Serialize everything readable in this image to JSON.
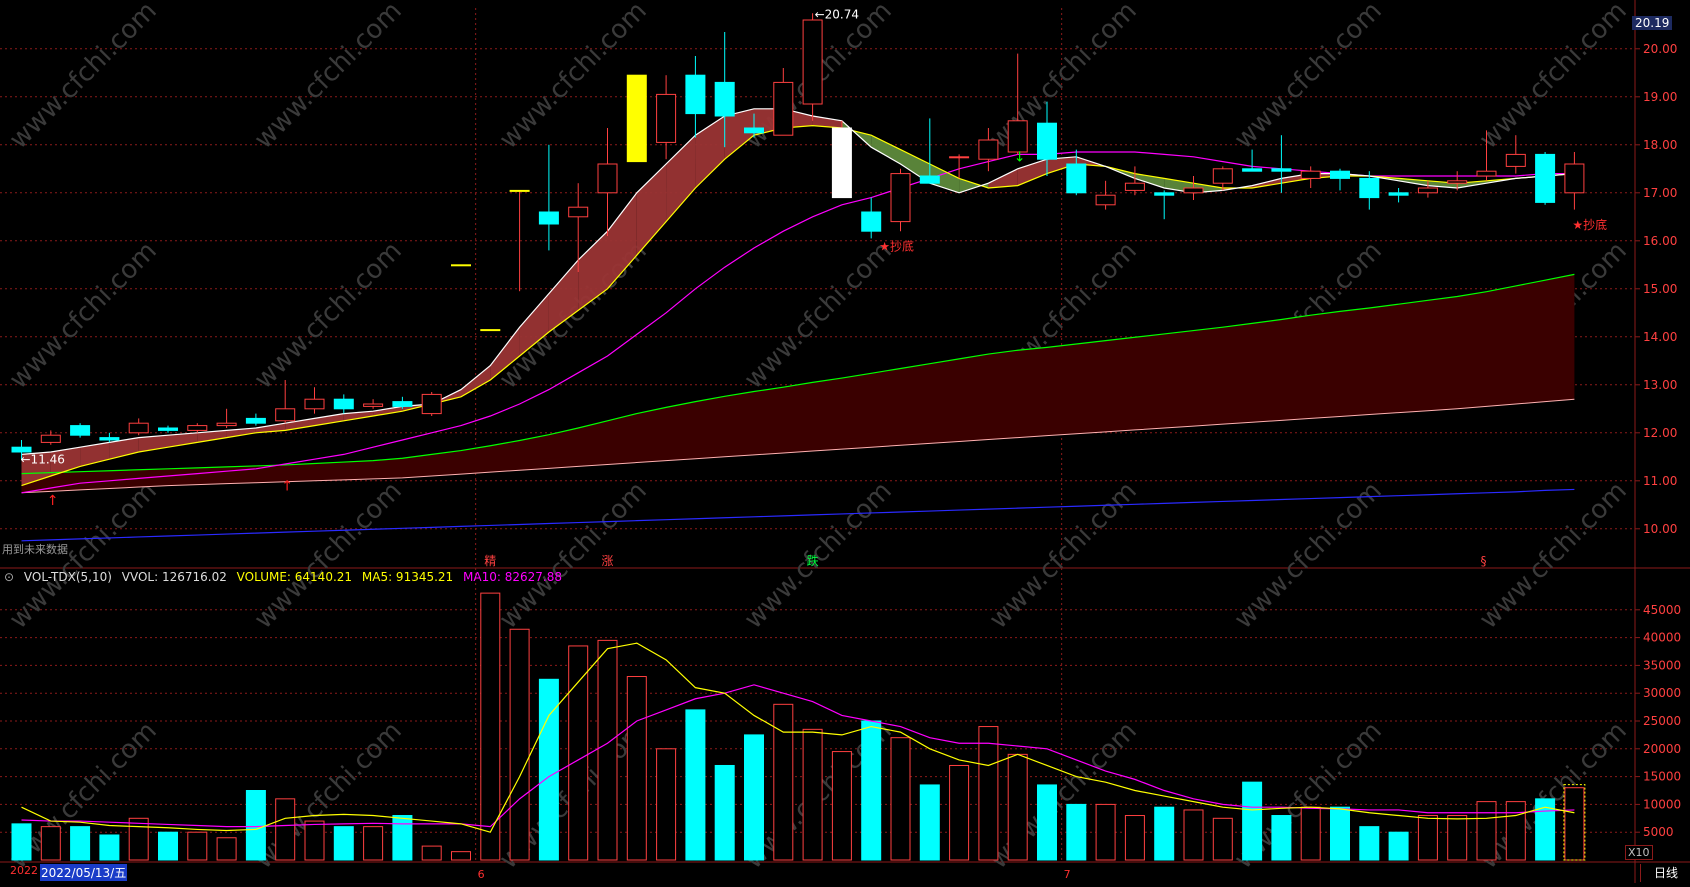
{
  "price_axis": {
    "labels": [
      "20.00",
      "19.00",
      "18.00",
      "17.00",
      "16.00",
      "15.00",
      "14.00",
      "13.00",
      "12.00",
      "11.00",
      "10.00"
    ],
    "current_tag": "20.19"
  },
  "volume_axis": {
    "labels": [
      "45000",
      "40000",
      "35000",
      "30000",
      "25000",
      "20000",
      "15000",
      "10000",
      "5000"
    ]
  },
  "price_annotations": {
    "high_label": "20.74",
    "low_label": "11.46",
    "signal_1": "★抄底",
    "signal_2": "★抄底"
  },
  "event_tags": [
    "精",
    "涨",
    "跌",
    "§"
  ],
  "hint_text": "用到未来数据",
  "indicator": {
    "name": "VOL-TDX(5,10)",
    "vvol": "VVOL: 126716.02",
    "volume": "VOLUME: 64140.21",
    "ma5": "MA5: 91345.21",
    "ma10": "MA10: 82627.88"
  },
  "x_axis": {
    "year_label": "2022",
    "selected_date": "2022/05/13/五",
    "month_6": "6",
    "month_7": "7",
    "scale_btn": "X10",
    "period_btn": "日线"
  },
  "watermark": "www.cfchi.com",
  "colors": {
    "bull": "#ff4040",
    "bear": "#00ffff",
    "ma5": "#ffffff",
    "ma10": "#ffff00",
    "ma20": "#ff00ff",
    "ma60": "#00ff00",
    "ma120": "#ffb0b0",
    "ma250": "#2a2aff",
    "grid": "#8b1a1a"
  },
  "chart_data": {
    "type": "candlestick",
    "candles": [
      [
        11.7,
        11.6,
        11.85,
        11.45
      ],
      [
        11.8,
        11.95,
        12.05,
        11.75
      ],
      [
        12.15,
        11.95,
        12.2,
        11.9
      ],
      [
        11.9,
        11.85,
        12.0,
        11.8
      ],
      [
        12.0,
        12.2,
        12.3,
        11.95
      ],
      [
        12.1,
        12.05,
        12.15,
        12.0
      ],
      [
        12.05,
        12.15,
        12.2,
        12.0
      ],
      [
        12.15,
        12.2,
        12.5,
        12.1
      ],
      [
        12.3,
        12.2,
        12.4,
        12.15
      ],
      [
        12.25,
        12.5,
        13.1,
        12.2
      ],
      [
        12.5,
        12.7,
        12.95,
        12.4
      ],
      [
        12.7,
        12.5,
        12.8,
        12.4
      ],
      [
        12.55,
        12.6,
        12.7,
        12.5
      ],
      [
        12.65,
        12.55,
        12.75,
        12.5
      ],
      [
        12.4,
        12.8,
        12.85,
        12.35
      ],
      [
        15.5,
        15.5,
        15.5,
        15.5
      ],
      [
        14.15,
        14.15,
        14.15,
        14.15
      ],
      [
        17.05,
        17.05,
        17.05,
        14.95
      ],
      [
        16.6,
        16.35,
        18.0,
        15.8
      ],
      [
        16.5,
        16.7,
        17.2,
        15.35
      ],
      [
        17.0,
        17.6,
        18.35,
        16.1
      ],
      [
        17.65,
        19.45,
        19.45,
        17.65
      ],
      [
        18.05,
        19.05,
        19.45,
        17.7
      ],
      [
        19.45,
        18.65,
        19.85,
        18.15
      ],
      [
        19.3,
        18.6,
        20.35,
        17.95
      ],
      [
        18.35,
        18.25,
        18.65,
        18.15
      ],
      [
        18.2,
        19.3,
        19.6,
        18.2
      ],
      [
        18.85,
        20.6,
        20.74,
        18.5
      ],
      [
        16.9,
        18.35,
        18.5,
        16.9
      ],
      [
        16.6,
        16.2,
        16.9,
        16.05
      ],
      [
        16.4,
        17.4,
        17.5,
        16.2
      ],
      [
        17.35,
        17.2,
        18.55,
        17.2
      ],
      [
        17.75,
        17.75,
        17.8,
        17.3
      ],
      [
        17.7,
        18.1,
        18.35,
        17.45
      ],
      [
        17.85,
        18.5,
        19.9,
        17.8
      ],
      [
        18.45,
        17.7,
        18.9,
        17.35
      ],
      [
        17.6,
        17.0,
        17.9,
        16.95
      ],
      [
        16.75,
        16.95,
        17.25,
        16.65
      ],
      [
        17.05,
        17.2,
        17.55,
        16.95
      ],
      [
        17.0,
        16.95,
        17.05,
        16.45
      ],
      [
        17.0,
        17.1,
        17.35,
        16.85
      ],
      [
        17.2,
        17.5,
        17.55,
        17.05
      ],
      [
        17.5,
        17.45,
        17.9,
        17.45
      ],
      [
        17.5,
        17.45,
        18.2,
        17.0
      ],
      [
        17.3,
        17.45,
        17.55,
        17.1
      ],
      [
        17.45,
        17.3,
        17.5,
        17.05
      ],
      [
        17.3,
        16.9,
        17.45,
        16.65
      ],
      [
        17.0,
        16.95,
        17.1,
        16.8
      ],
      [
        17.0,
        17.1,
        17.25,
        16.9
      ],
      [
        17.2,
        17.25,
        17.45,
        17.05
      ],
      [
        17.35,
        17.45,
        18.3,
        17.25
      ],
      [
        17.55,
        17.8,
        18.2,
        17.4
      ],
      [
        17.8,
        16.8,
        17.85,
        16.75
      ],
      [
        17.0,
        17.6,
        17.85,
        16.65
      ]
    ],
    "volume": [
      6.5,
      6.0,
      6.0,
      4.5,
      7.5,
      5.0,
      5.0,
      4.0,
      12.5,
      11.0,
      7.0,
      6.0,
      6.0,
      8.0,
      2.5,
      1.5,
      48.0,
      41.5,
      32.5,
      38.5,
      39.5,
      33.0,
      20.0,
      27.0,
      17.0,
      22.5,
      28.0,
      23.5,
      19.5,
      25.0,
      22.0,
      13.5,
      17.0,
      24.0,
      19.0,
      13.5,
      10.0,
      10.0,
      8.0,
      9.5,
      9.0,
      7.5,
      14.0,
      8.0,
      9.5,
      9.5,
      6.0,
      5.0,
      8.0,
      8.0,
      10.5,
      10.5,
      11.0,
      13.0
    ],
    "vol_ma5": [
      9.5,
      7.0,
      6.8,
      6.2,
      6.0,
      5.8,
      5.5,
      5.3,
      5.5,
      7.5,
      8.0,
      8.2,
      8.0,
      7.5,
      7.0,
      6.5,
      5.0,
      15.0,
      26.0,
      32.0,
      38.0,
      39.0,
      36.0,
      31.0,
      30.0,
      26.0,
      23.0,
      23.0,
      22.5,
      24.0,
      23.0,
      20.0,
      18.0,
      17.0,
      19.0,
      17.0,
      15.0,
      14.0,
      12.5,
      11.5,
      10.5,
      9.5,
      9.0,
      9.3,
      9.5,
      9.2,
      8.5,
      8.0,
      7.5,
      7.4,
      7.5,
      8.0,
      9.5,
      8.5
    ],
    "vol_ma10": [
      7.2,
      7.0,
      7.0,
      6.8,
      6.6,
      6.4,
      6.2,
      6.0,
      6.0,
      6.2,
      6.4,
      6.5,
      6.6,
      6.5,
      6.5,
      6.5,
      6.0,
      11.0,
      15.0,
      18.0,
      21.0,
      25.0,
      27.0,
      29.0,
      30.0,
      31.5,
      30.0,
      28.5,
      26.0,
      25.0,
      24.0,
      22.0,
      21.0,
      21.0,
      20.5,
      20.0,
      18.0,
      16.0,
      14.5,
      12.5,
      11.0,
      10.0,
      9.5,
      9.5,
      9.3,
      9.2,
      9.0,
      9.0,
      8.5,
      8.5,
      8.5,
      8.5,
      8.8,
      9.0
    ],
    "ma5": [
      11.55,
      11.6,
      11.7,
      11.8,
      11.9,
      11.95,
      12.0,
      12.05,
      12.1,
      12.2,
      12.3,
      12.4,
      12.45,
      12.55,
      12.6,
      12.9,
      13.4,
      14.2,
      14.9,
      15.6,
      16.2,
      17.0,
      17.6,
      18.2,
      18.6,
      18.75,
      18.75,
      18.6,
      18.5,
      17.95,
      17.6,
      17.2,
      17.0,
      17.2,
      17.5,
      17.7,
      17.75,
      17.55,
      17.3,
      17.1,
      17.0,
      17.05,
      17.15,
      17.3,
      17.4,
      17.4,
      17.35,
      17.25,
      17.15,
      17.1,
      17.2,
      17.3,
      17.35,
      17.4
    ],
    "ma10": [
      10.9,
      11.1,
      11.3,
      11.45,
      11.6,
      11.7,
      11.8,
      11.9,
      12.0,
      12.05,
      12.15,
      12.25,
      12.35,
      12.45,
      12.6,
      12.75,
      13.1,
      13.6,
      14.1,
      14.55,
      15.0,
      15.7,
      16.4,
      17.1,
      17.7,
      18.2,
      18.35,
      18.4,
      18.35,
      18.2,
      17.9,
      17.6,
      17.3,
      17.1,
      17.15,
      17.4,
      17.6,
      17.55,
      17.4,
      17.3,
      17.2,
      17.1,
      17.1,
      17.2,
      17.3,
      17.35,
      17.35,
      17.3,
      17.25,
      17.2,
      17.25,
      17.3,
      17.35,
      17.4
    ],
    "ma20": [
      10.75,
      10.85,
      10.95,
      11.0,
      11.05,
      11.1,
      11.15,
      11.2,
      11.25,
      11.35,
      11.45,
      11.55,
      11.7,
      11.85,
      12.0,
      12.15,
      12.35,
      12.6,
      12.9,
      13.25,
      13.6,
      14.05,
      14.5,
      15.0,
      15.45,
      15.85,
      16.2,
      16.5,
      16.75,
      16.9,
      17.1,
      17.3,
      17.5,
      17.65,
      17.8,
      17.8,
      17.85,
      17.85,
      17.85,
      17.8,
      17.75,
      17.65,
      17.55,
      17.5,
      17.45,
      17.4,
      17.35,
      17.35,
      17.35,
      17.35,
      17.35,
      17.35,
      17.4,
      17.4
    ],
    "ma60": [
      11.15,
      11.17,
      11.19,
      11.21,
      11.23,
      11.25,
      11.27,
      11.29,
      11.31,
      11.33,
      11.36,
      11.39,
      11.42,
      11.47,
      11.55,
      11.63,
      11.73,
      11.84,
      11.96,
      12.1,
      12.25,
      12.4,
      12.53,
      12.65,
      12.76,
      12.86,
      12.95,
      13.05,
      13.14,
      13.24,
      13.34,
      13.44,
      13.54,
      13.64,
      13.72,
      13.78,
      13.85,
      13.92,
      13.99,
      14.06,
      14.13,
      14.2,
      14.28,
      14.36,
      14.45,
      14.53,
      14.6,
      14.68,
      14.76,
      14.84,
      14.94,
      15.06,
      15.18,
      15.3
    ],
    "ma120": [
      10.75,
      10.78,
      10.81,
      10.84,
      10.87,
      10.9,
      10.92,
      10.94,
      10.96,
      10.98,
      11.0,
      11.02,
      11.04,
      11.06,
      11.1,
      11.14,
      11.18,
      11.22,
      11.26,
      11.3,
      11.34,
      11.38,
      11.42,
      11.46,
      11.5,
      11.54,
      11.58,
      11.62,
      11.66,
      11.7,
      11.74,
      11.78,
      11.82,
      11.86,
      11.9,
      11.94,
      11.98,
      12.02,
      12.06,
      12.1,
      12.14,
      12.18,
      12.22,
      12.26,
      12.3,
      12.34,
      12.38,
      12.42,
      12.46,
      12.5,
      12.55,
      12.6,
      12.65,
      12.7
    ],
    "ma250": [
      9.75,
      9.77,
      9.79,
      9.81,
      9.83,
      9.85,
      9.87,
      9.89,
      9.91,
      9.93,
      9.95,
      9.97,
      9.99,
      10.01,
      10.03,
      10.05,
      10.07,
      10.09,
      10.11,
      10.13,
      10.15,
      10.17,
      10.19,
      10.21,
      10.23,
      10.25,
      10.27,
      10.29,
      10.31,
      10.33,
      10.35,
      10.37,
      10.39,
      10.41,
      10.43,
      10.45,
      10.47,
      10.49,
      10.51,
      10.53,
      10.55,
      10.57,
      10.59,
      10.61,
      10.63,
      10.65,
      10.67,
      10.69,
      10.71,
      10.73,
      10.75,
      10.77,
      10.8,
      10.82
    ],
    "price_range": [
      9.6,
      20.85
    ],
    "volume_range": [
      0,
      50000
    ]
  }
}
